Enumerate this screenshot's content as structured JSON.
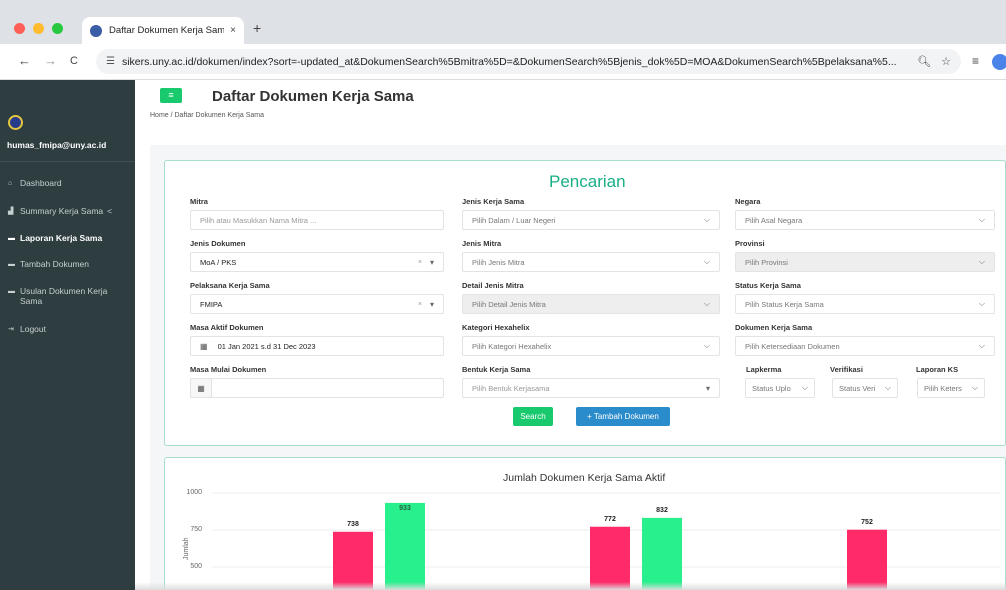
{
  "browser": {
    "tab_title": "Daftar Dokumen Kerja Sama",
    "tab_close": "×",
    "new_tab": "+",
    "back": "←",
    "forward": "→",
    "reload": "C",
    "url": "sikers.uny.ac.id/dokumen/index?sort=-updated_at&DokumenSearch%5Bmitra%5D=&DokumenSearch%5Bjenis_dok%5D=MOA&DokumenSearch%5Bpelaksana%5...",
    "zoom_icon": "zoom-icon",
    "star_icon": "star-icon"
  },
  "sidebar": {
    "user": "humas_fmipa@uny.ac.id",
    "items": [
      {
        "label": "Dashboard",
        "icon": "home-icon"
      },
      {
        "label": "Summary Kerja Sama",
        "icon": "chart-icon",
        "chevron": "<"
      },
      {
        "label": "Laporan Kerja Sama",
        "icon": "folder-icon"
      },
      {
        "label": "Tambah Dokumen",
        "icon": "folder-icon"
      },
      {
        "label": "Usulan Dokumen Kerja Sama",
        "icon": "folder-icon"
      },
      {
        "label": "Logout",
        "icon": "logout-icon"
      }
    ]
  },
  "header": {
    "menu_icon": "≡",
    "title": "Daftar Dokumen Kerja Sama",
    "breadcrumb": "Home  /  Daftar Dokumen Kerja Sama"
  },
  "search": {
    "title": "Pencarian",
    "mitra": {
      "label": "Mitra",
      "placeholder": "Pilih atau Masukkan Nama Mitra ..."
    },
    "jenis_kerja_sama": {
      "label": "Jenis Kerja Sama",
      "value": "Pilih Dalam / Luar Negeri"
    },
    "negara": {
      "label": "Negara",
      "value": "Pilih Asal Negara"
    },
    "jenis_dokumen": {
      "label": "Jenis Dokumen",
      "value": "MoA / PKS"
    },
    "jenis_mitra": {
      "label": "Jenis Mitra",
      "value": "Pilih Jenis Mitra"
    },
    "provinsi": {
      "label": "Provinsi",
      "value": "Pilih Provinsi"
    },
    "pelaksana": {
      "label": "Pelaksana Kerja Sama",
      "value": "FMIPA"
    },
    "detail_jenis_mitra": {
      "label": "Detail Jenis Mitra",
      "value": "Pilih Detail Jenis Mitra"
    },
    "status_kerja_sama": {
      "label": "Status Kerja Sama",
      "value": "Pilih Status Kerja Sama"
    },
    "masa_aktif": {
      "label": "Masa Aktif Dokumen",
      "value": "01 Jan 2021 s.d 31 Dec 2023"
    },
    "kategori_hexahelix": {
      "label": "Kategori Hexahelix",
      "value": "Pilih Kategori Hexahelix"
    },
    "dokumen_kerja_sama": {
      "label": "Dokumen Kerja Sama",
      "value": "Pilih Ketersediaan Dokumen"
    },
    "masa_mulai": {
      "label": "Masa Mulai Dokumen",
      "value": ""
    },
    "bentuk_kerja_sama": {
      "label": "Bentuk Kerja Sama",
      "value": "Pilih Bentuk Kerjasama"
    },
    "lapkerma": {
      "label": "Lapkerma",
      "value": "Status Uplo"
    },
    "verifikasi": {
      "label": "Verifikasi",
      "value": "Status Veri"
    },
    "laporan_ks": {
      "label": "Laporan KS",
      "value": "Pilih Keters"
    },
    "search_button": "Search",
    "add_button": "+ Tambah Dokumen"
  },
  "chart_data": {
    "type": "bar",
    "title": "Jumlah Dokumen Kerja Sama Aktif",
    "ylabel": "Jumlah",
    "yticks": [
      500,
      750,
      1000
    ],
    "ylim": [
      0,
      1000
    ],
    "grid": true,
    "groups": [
      {
        "values": [
          738,
          933
        ]
      },
      {
        "values": [
          772,
          832
        ]
      },
      {
        "values": [
          752
        ]
      }
    ],
    "colors": [
      "#ff2a68",
      "#28f08c"
    ]
  }
}
